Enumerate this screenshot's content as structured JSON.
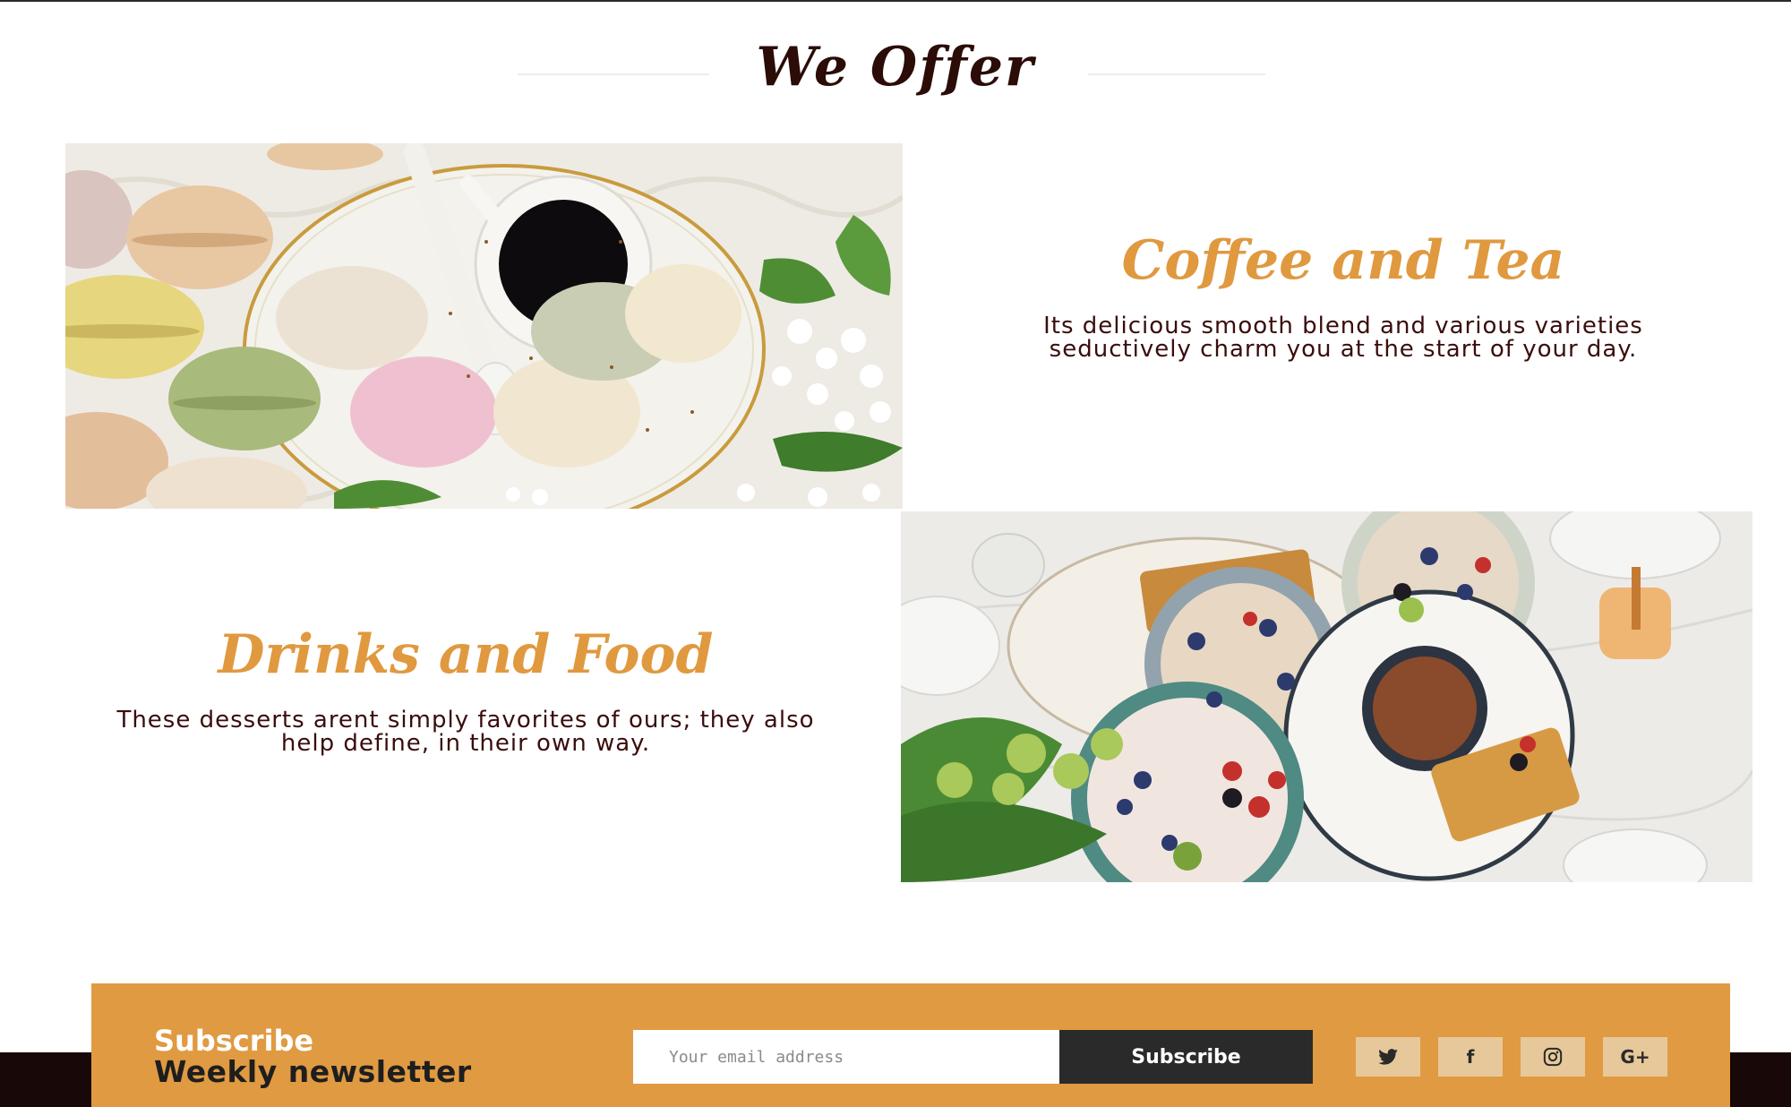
{
  "section": {
    "title": "We Offer"
  },
  "offers": [
    {
      "title": "Coffee and Tea",
      "description": "Its delicious smooth blend and various varieties seductively charm you at the start of your day.",
      "image": "macarons-and-coffee-photo"
    },
    {
      "title": "Drinks and Food",
      "description": "These desserts arent simply favorites of ours; they also help define, in their own way.",
      "image": "breakfast-spread-photo"
    }
  ],
  "newsletter": {
    "heading_line1": "Subscribe",
    "heading_line2": "Weekly newsletter",
    "email_placeholder": "Your email address",
    "subscribe_label": "Subscribe"
  },
  "social": {
    "twitter_icon": "twitter-icon",
    "facebook_icon": "facebook-icon",
    "instagram_icon": "instagram-icon",
    "gplus_icon": "google-plus-icon",
    "gplus_glyph": "G+",
    "facebook_glyph": "f"
  },
  "colors": {
    "accent": "#e09a42",
    "title_dark": "#2b0c07",
    "text_dark": "#3a0d0c",
    "button_dark": "#2a2a2a",
    "footer_dark": "#180807"
  }
}
